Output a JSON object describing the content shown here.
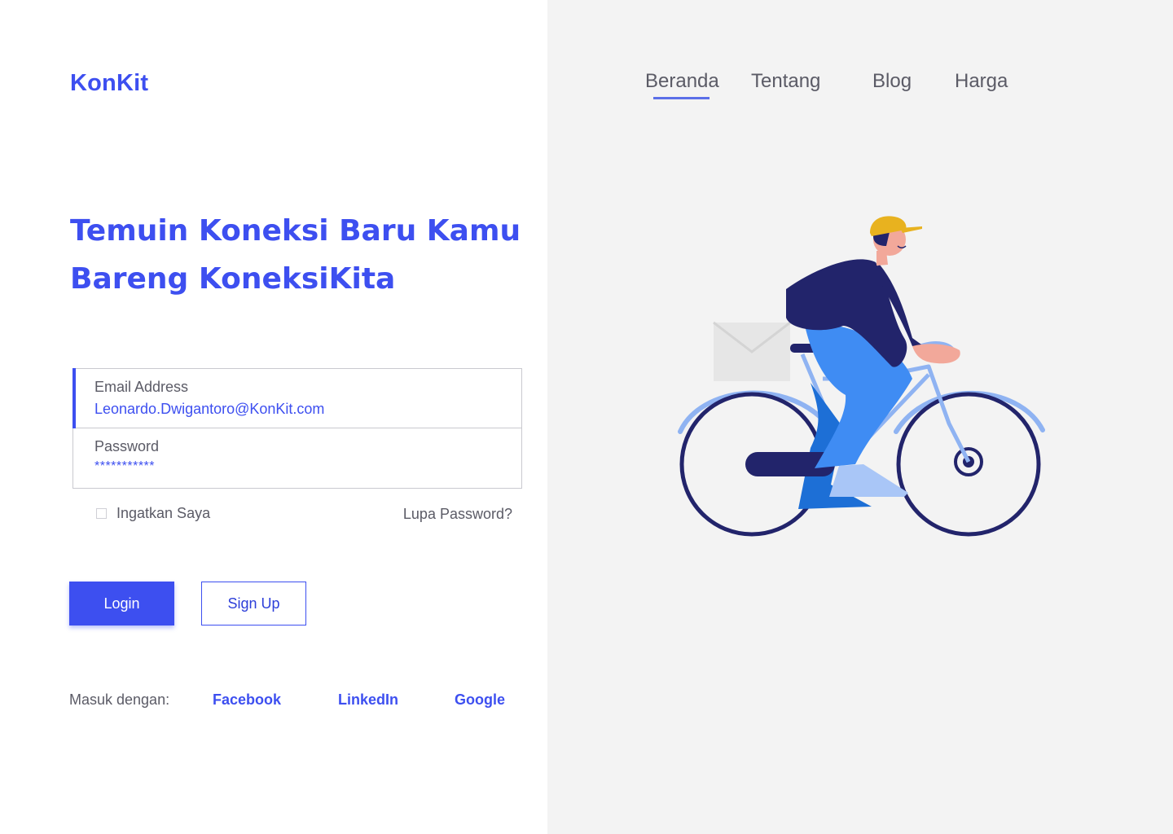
{
  "brand": {
    "logo": "KonKit"
  },
  "hero": {
    "line1": "Temuin Koneksi Baru Kamu",
    "line2": "Bareng KoneksiKita"
  },
  "form": {
    "email": {
      "label": "Email Address",
      "value": "Leonardo.Dwigantoro@KonKit.com"
    },
    "password": {
      "label": "Password",
      "value": "***********"
    },
    "remember_label": "Ingatkan Saya",
    "remember_checked": false,
    "forgot_label": "Lupa Password?",
    "login_label": "Login",
    "signup_label": "Sign Up"
  },
  "social": {
    "label": "Masuk dengan:",
    "providers": [
      "Facebook",
      "LinkedIn",
      "Google"
    ]
  },
  "nav": {
    "items": [
      "Beranda",
      "Tentang",
      "Blog",
      "Harga"
    ],
    "active": "Beranda"
  },
  "illustration": {
    "icon": "cyclist-illustration"
  },
  "colors": {
    "accent": "#3d4ff0",
    "right_panel_bg": "#f3f3f3",
    "text_muted": "#5b5b66"
  }
}
